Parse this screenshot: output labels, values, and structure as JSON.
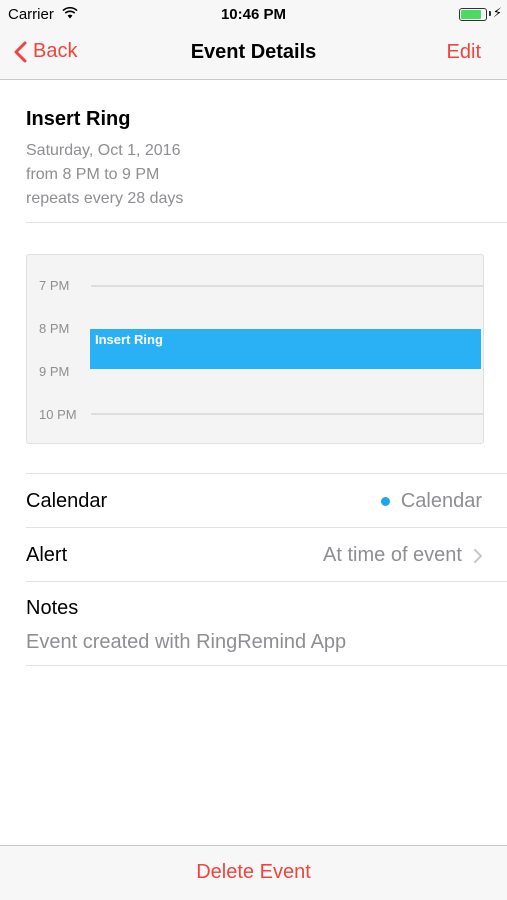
{
  "status_bar": {
    "carrier": "Carrier",
    "time": "10:46 PM",
    "battery_level": 0.75
  },
  "nav": {
    "back_label": "Back",
    "title": "Event Details",
    "edit_label": "Edit"
  },
  "event": {
    "title": "Insert Ring",
    "date": "Saturday, Oct 1, 2016",
    "time_range": "from 8 PM to 9 PM",
    "repeat": "repeats every 28 days"
  },
  "timeline": {
    "hours": [
      "7 PM",
      "8 PM",
      "9 PM",
      "10 PM"
    ],
    "event_label": "Insert Ring",
    "event_color": "#2ab0f4"
  },
  "details": {
    "calendar_label": "Calendar",
    "calendar_value": "Calendar",
    "calendar_color": "#1ba7ee",
    "alert_label": "Alert",
    "alert_value": "At time of event",
    "notes_label": "Notes",
    "notes_text": "Event created with RingRemind App"
  },
  "toolbar": {
    "delete_label": "Delete Event"
  },
  "colors": {
    "accent": "#f0443c",
    "secondary_text": "#8e8e93"
  },
  "icons": [
    "wifi-icon",
    "battery-icon",
    "charging-bolt-icon",
    "chevron-left-icon",
    "chevron-right-icon",
    "calendar-dot-icon"
  ]
}
